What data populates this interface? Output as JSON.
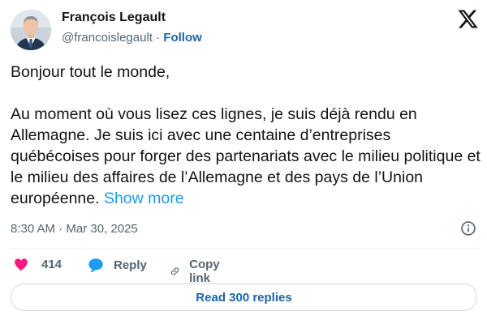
{
  "author": {
    "name": "François Legault",
    "handle": "@francoislegault",
    "separator": "·",
    "follow_label": "Follow"
  },
  "post": {
    "greeting": "Bonjour tout le monde,",
    "body": "Au moment où vous lisez ces lignes, je suis déjà rendu en Allemagne. Je suis ici avec une centaine d’entreprises québécoises pour forger des partenariats avec le milieu politique et le milieu des affaires de l’Allemagne et des pays de l’Union européenne.",
    "show_more_label": "Show more",
    "timestamp": "8:30 AM · Mar 30, 2025"
  },
  "actions": {
    "likes": "414",
    "reply_label": "Reply",
    "copy_link_label": "Copy link"
  },
  "read_replies_label": "Read 300 replies",
  "icons": {
    "logo": "x-logo-icon",
    "info": "info-icon",
    "like": "heart-icon",
    "reply": "speech-bubble-icon",
    "copy": "link-icon"
  },
  "colors": {
    "text": "#0f1419",
    "secondary": "#536471",
    "link": "#1d9bf0",
    "follow": "#1d64a8",
    "like": "#f91880",
    "reply": "#1d9bf0"
  }
}
